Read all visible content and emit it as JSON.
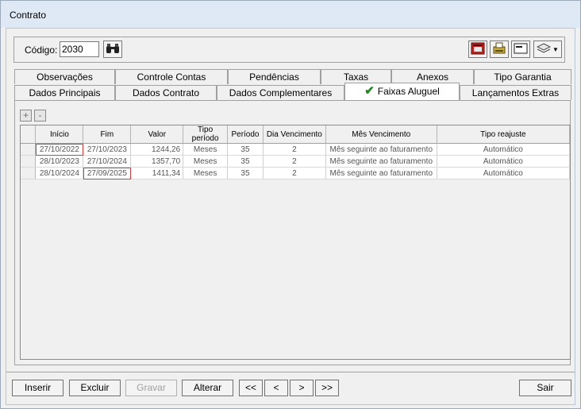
{
  "window": {
    "title": "Contrato"
  },
  "header": {
    "codigo_label": "Código:",
    "codigo_value": "2030"
  },
  "tabs_row1": [
    "Observações",
    "Controle Contas",
    "Pendências",
    "Taxas",
    "Anexos",
    "Tipo Garantia"
  ],
  "tabs_row2": [
    "Dados Principais",
    "Dados Contrato",
    "Dados Complementares",
    "Faixas Aluguel",
    "Lançamentos Extras"
  ],
  "grid": {
    "add_label": "+",
    "remove_label": "-",
    "columns": [
      "Início",
      "Fim",
      "Valor",
      "Tipo período",
      "Período",
      "Dia Vencimento",
      "Mês Vencimento",
      "Tipo reajuste"
    ],
    "rows": [
      [
        "27/10/2022",
        "27/10/2023",
        "1244,26",
        "Meses",
        "35",
        "2",
        "Mês seguinte ao faturamento",
        "Automático"
      ],
      [
        "28/10/2023",
        "27/10/2024",
        "1357,70",
        "Meses",
        "35",
        "2",
        "Mês seguinte ao faturamento",
        "Automático"
      ],
      [
        "28/10/2024",
        "27/09/2025",
        "1411,34",
        "Meses",
        "35",
        "2",
        "Mês seguinte ao faturamento",
        "Automático"
      ]
    ]
  },
  "buttons": {
    "inserir": "Inserir",
    "excluir": "Excluir",
    "gravar": "Gravar",
    "alterar": "Alterar",
    "first": "<<",
    "prev": "<",
    "next": ">",
    "last": ">>",
    "sair": "Sair"
  },
  "icons": {
    "search": "binoculars-icon",
    "phone": "phone-icon",
    "print": "printer-icon",
    "card": "card-icon",
    "layers": "layers-icon"
  }
}
